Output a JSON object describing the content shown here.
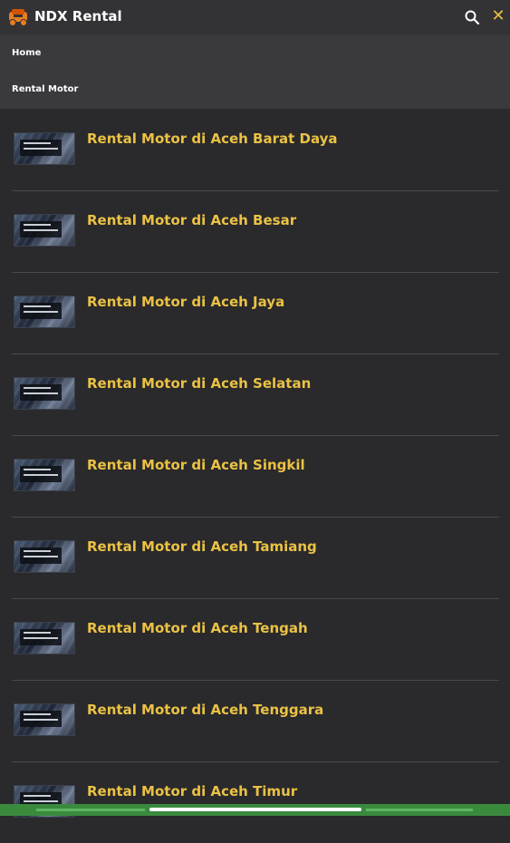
{
  "header": {
    "app_title": "NDX Rental",
    "logo_icon": "motorcycle-logo-icon",
    "search_icon": "search-icon",
    "close_symbol": "✕",
    "accent_color": "#eac244"
  },
  "menu": {
    "items": [
      {
        "label": "Home"
      },
      {
        "label": "Rental Motor"
      }
    ]
  },
  "list": {
    "items": [
      {
        "title": "Rental Motor di Aceh Barat Daya"
      },
      {
        "title": "Rental Motor di Aceh Besar"
      },
      {
        "title": "Rental Motor di Aceh Jaya"
      },
      {
        "title": "Rental Motor di Aceh Selatan"
      },
      {
        "title": "Rental Motor di Aceh Singkil"
      },
      {
        "title": "Rental Motor di Aceh Tamiang"
      },
      {
        "title": "Rental Motor di Aceh Tengah"
      },
      {
        "title": "Rental Motor di Aceh Tenggara"
      },
      {
        "title": "Rental Motor di Aceh Timur"
      }
    ]
  }
}
